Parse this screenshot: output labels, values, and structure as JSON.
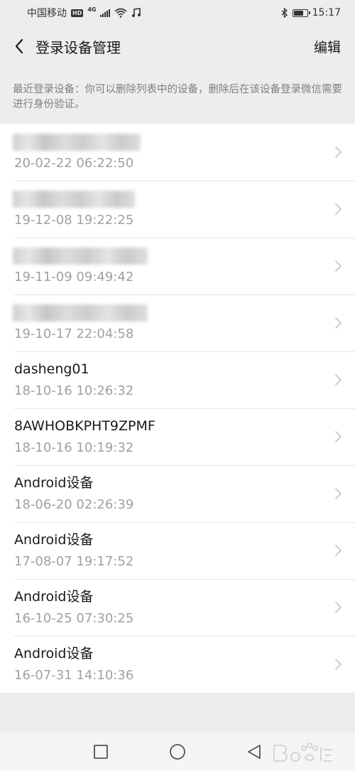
{
  "status_bar": {
    "carrier": "中国移动",
    "hd_badge": "HD",
    "network": "4G",
    "time": "15:17",
    "battery_level": 0.75
  },
  "nav": {
    "title": "登录设备管理",
    "edit_label": "编辑"
  },
  "hint": {
    "text": "最近登录设备：你可以删除列表中的设备，删除后在该设备登录微信需要进行身份验证。"
  },
  "devices": [
    {
      "name": "",
      "time": "20-02-22 06:22:50"
    },
    {
      "name": "",
      "time": "19-12-08 19:22:25"
    },
    {
      "name": "",
      "time": "19-11-09 09:49:42"
    },
    {
      "name": "",
      "time": "19-10-17 22:04:58"
    },
    {
      "name": "dasheng01",
      "time": "18-10-16 10:26:32"
    },
    {
      "name": "8AWHOBKPHT9ZPMF",
      "time": "18-10-16 10:19:32"
    },
    {
      "name": "Android设备",
      "time": "18-06-20 02:26:39"
    },
    {
      "name": "Android设备",
      "time": "17-08-07 19:17:52"
    },
    {
      "name": "Android设备",
      "time": "16-10-25 07:30:25"
    },
    {
      "name": "Android设备",
      "time": "16-07-31 14:10:36"
    }
  ],
  "icons": {
    "back": "back-arrow-icon",
    "chevron": "chevron-right-icon",
    "recent_apps": "square-icon",
    "home": "circle-icon",
    "back_key": "triangle-back-icon"
  },
  "colors": {
    "background": "#ededed",
    "list_bg": "#ffffff",
    "primary_text": "#191919",
    "secondary_text": "#a0a0a0",
    "hint_text": "#7f7f7f"
  }
}
